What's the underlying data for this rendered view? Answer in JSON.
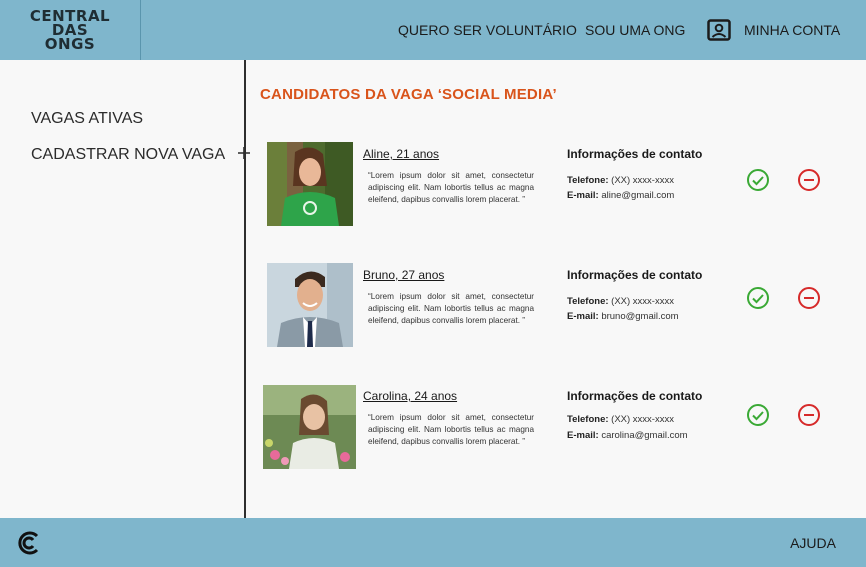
{
  "header": {
    "logo_lines": [
      "CENTRAL",
      "DAS",
      "ONGS"
    ],
    "nav": {
      "volunteer": "QUERO SER VOLUNTÁRIO",
      "ngo": "SOU UMA ONG",
      "account": "MINHA CONTA"
    }
  },
  "sidebar": {
    "active_jobs": "VAGAS ATIVAS",
    "new_job": "CADASTRAR NOVA VAGA",
    "new_job_icon": "plus-icon"
  },
  "main": {
    "title": "CANDIDATOS DA VAGA ‘SOCIAL MEDIA’",
    "candidates": [
      {
        "name": "Aline, 21 anos",
        "bio": "“Lorem ipsum dolor sit amet, consectetur adipiscing elit. Nam lobortis tellus ac magna eleifend, dapibus convallis lorem placerat. ”",
        "contact_title": "Informações de contato",
        "phone_label": "Telefone:",
        "phone": "(XX) xxxx-xxxx",
        "email_label": "E-mail:",
        "email": "aline@gmail.com"
      },
      {
        "name": "Bruno, 27 anos",
        "bio": "“Lorem ipsum dolor sit amet, consectetur adipiscing elit. Nam lobortis tellus ac magna eleifend, dapibus convallis lorem placerat. ”",
        "contact_title": "Informações de contato",
        "phone_label": "Telefone:",
        "phone": "(XX) xxxx-xxxx",
        "email_label": "E-mail:",
        "email": "bruno@gmail.com"
      },
      {
        "name": "Carolina, 24 anos",
        "bio": "“Lorem ipsum dolor sit amet, consectetur adipiscing elit. Nam lobortis tellus ac magna eleifend, dapibus convallis lorem placerat. ”",
        "contact_title": "Informações de contato",
        "phone_label": "Telefone:",
        "phone": "(XX) xxxx-xxxx",
        "email_label": "E-mail:",
        "email": "carolina@gmail.com"
      }
    ]
  },
  "footer": {
    "help": "AJUDA"
  },
  "colors": {
    "header_bg": "#7fb6cc",
    "title": "#d9541b",
    "accept": "#3aa935",
    "reject": "#d62a2a"
  }
}
